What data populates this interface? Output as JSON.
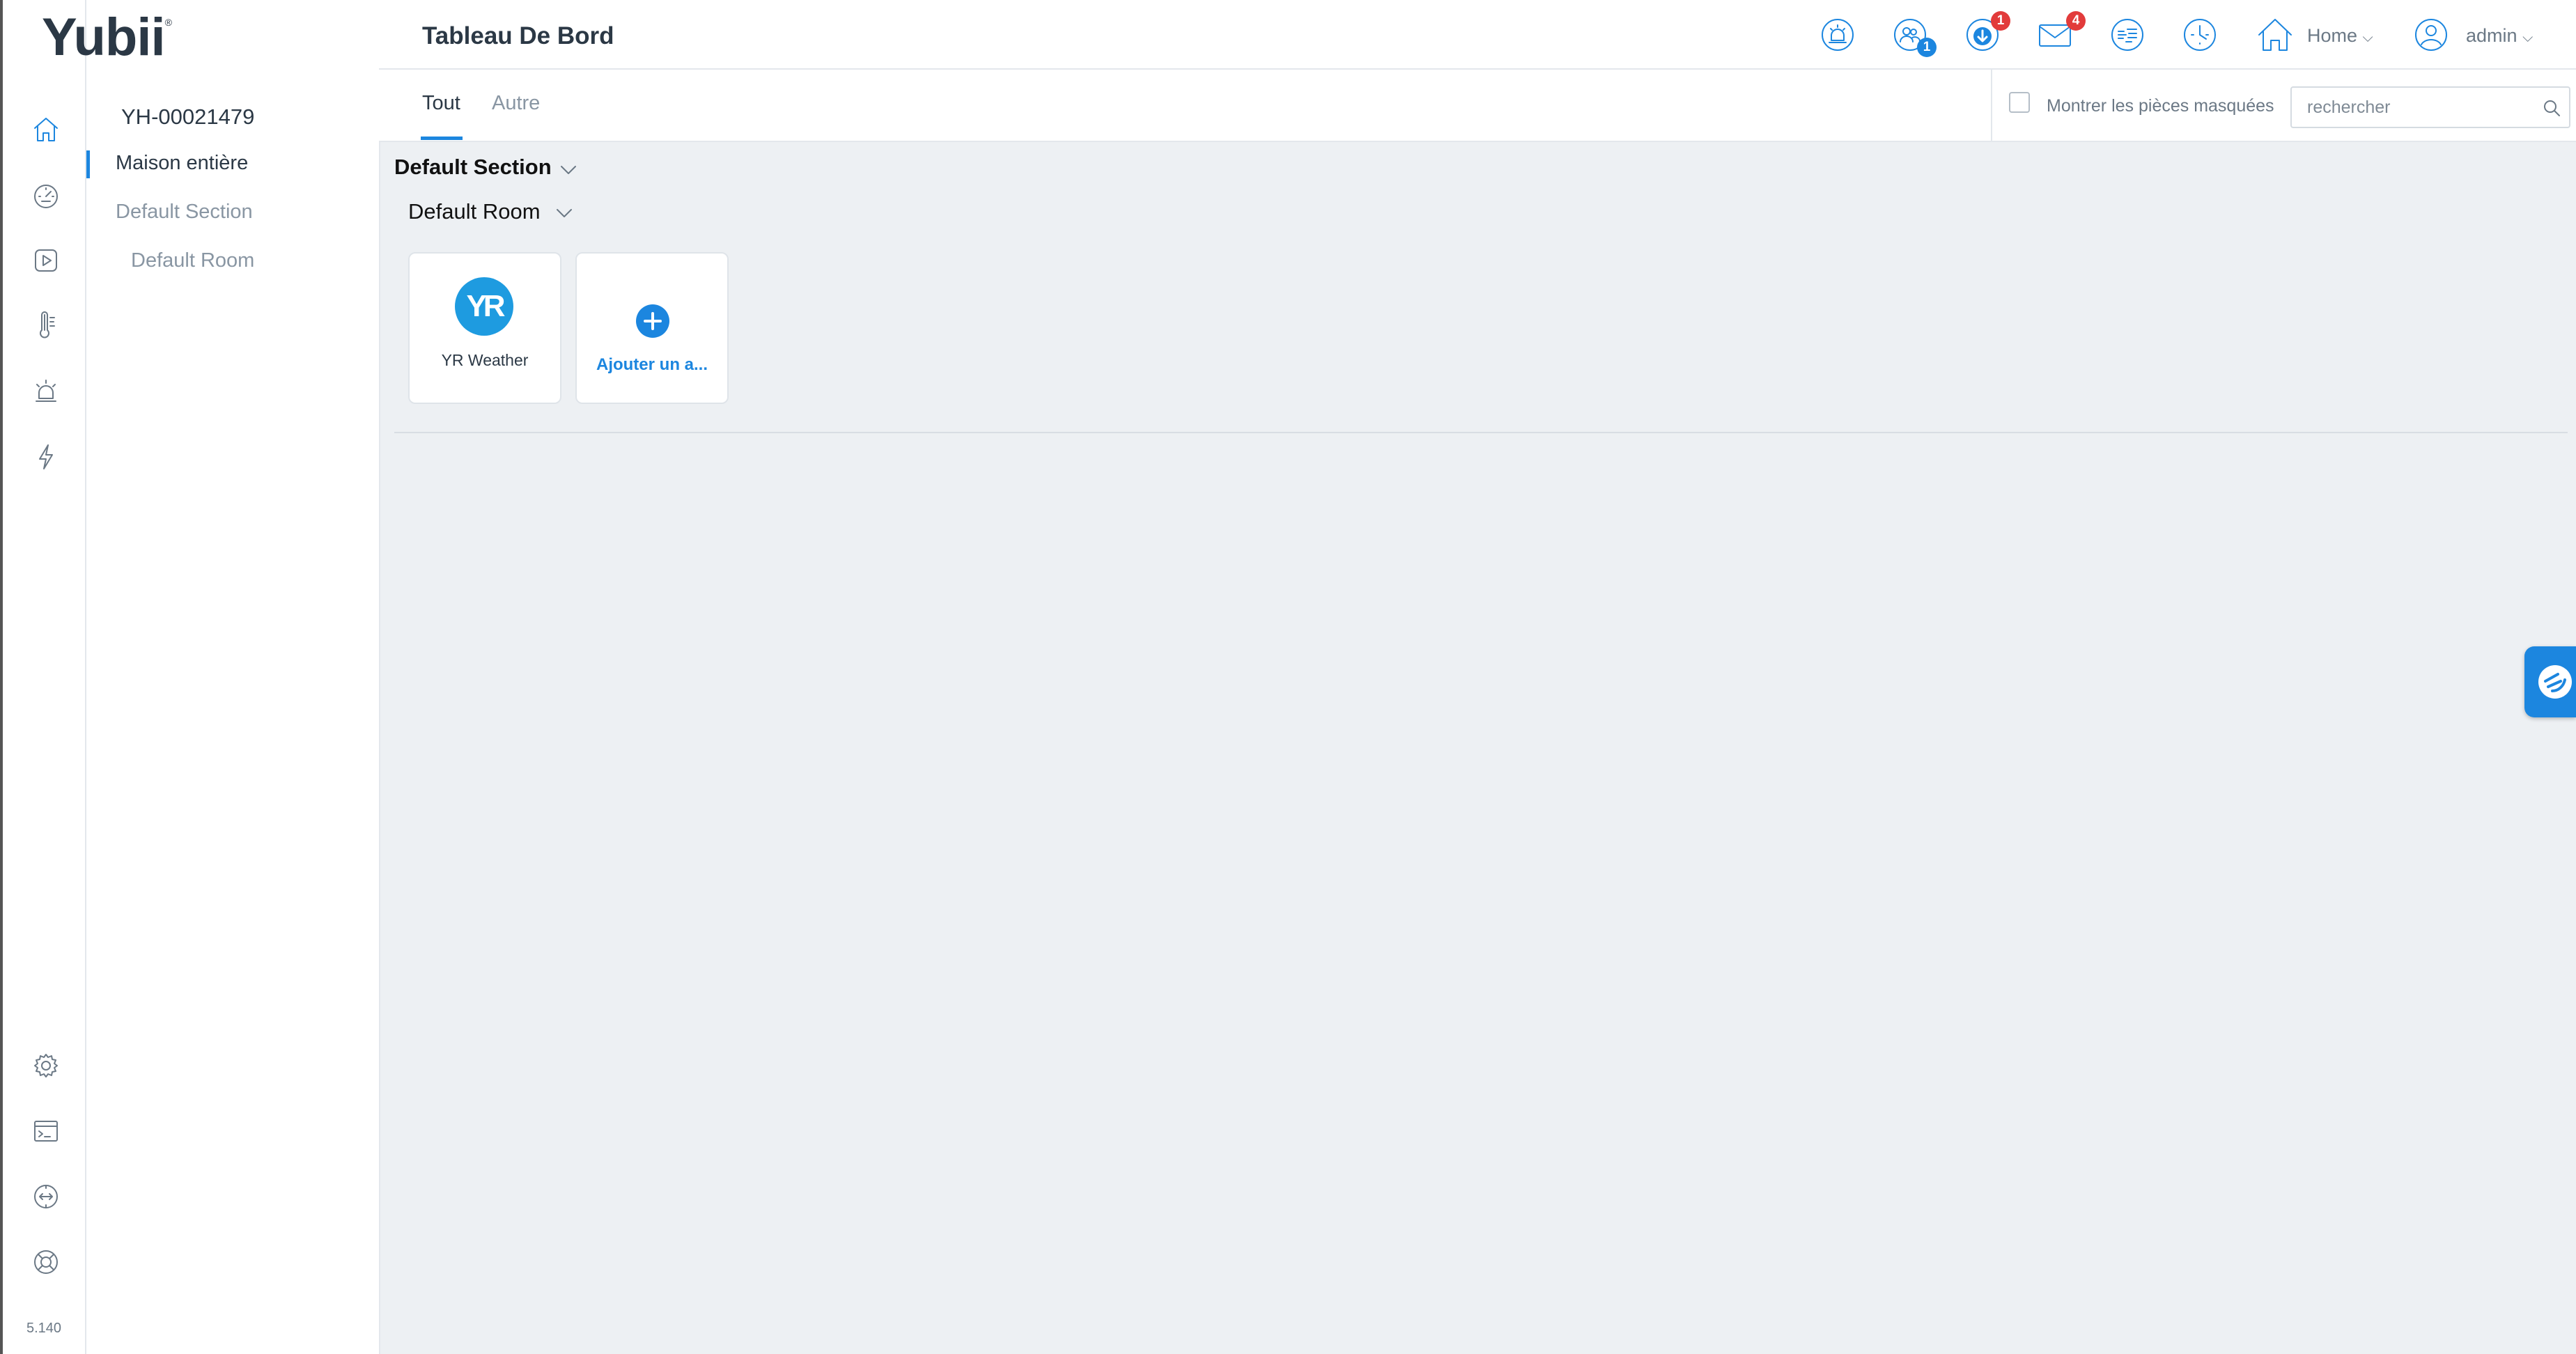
{
  "app": {
    "logo": "Yubii",
    "version": "5.140"
  },
  "header": {
    "title": "Tableau De Bord",
    "badges": {
      "users": "1",
      "updates": "1",
      "messages": "4"
    },
    "home_label": "Home",
    "user_label": "admin"
  },
  "tree": {
    "gateway_id": "YH-00021479",
    "items": [
      "Maison entière",
      "Default Section",
      "Default Room"
    ]
  },
  "tabs": [
    "Tout",
    "Autre"
  ],
  "tools": {
    "show_hidden_label": "Montrer les pièces masquées",
    "search_placeholder": "rechercher"
  },
  "main": {
    "section": "Default Section",
    "room": "Default Room",
    "tiles": [
      {
        "logo": "YR",
        "label": "YR Weather"
      },
      {
        "label": "Ajouter un a..."
      }
    ]
  },
  "colors": {
    "accent": "#1c86df",
    "badge_red": "#e23b3b",
    "content_bg": "#edf0f3"
  },
  "icons": {
    "nav": [
      "home-icon",
      "dashboard-icon",
      "scenes-icon",
      "climate-icon",
      "alarm-icon",
      "energy-icon",
      "settings-icon",
      "terminal-icon",
      "network-icon",
      "support-icon"
    ],
    "header": [
      "alarm-icon",
      "users-icon",
      "download-icon",
      "mail-icon",
      "climate-zones-icon",
      "clock-icon",
      "house-icon",
      "user-avatar-icon"
    ]
  }
}
